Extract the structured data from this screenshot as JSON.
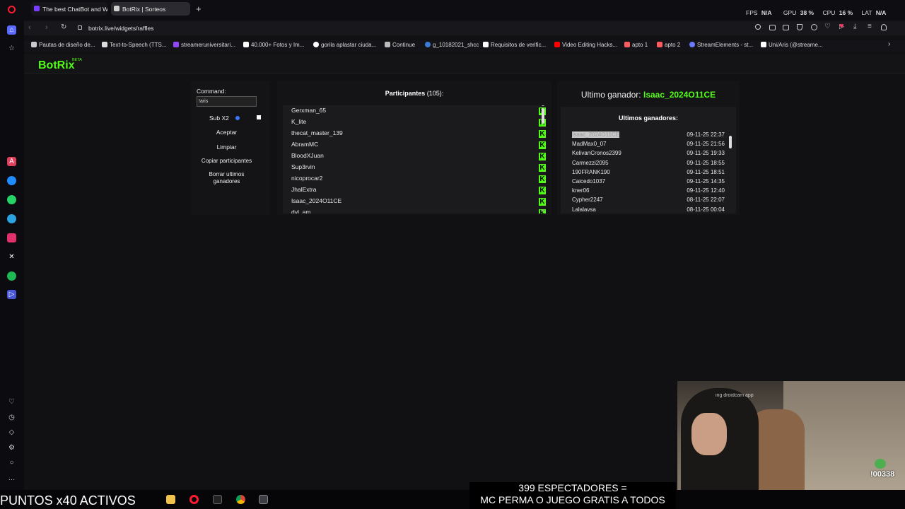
{
  "browser": {
    "tabs": [
      {
        "label": "The best ChatBot and Wi",
        "active": false
      },
      {
        "label": "BotRix | Sorteos",
        "active": true
      }
    ],
    "url": "botrix.live/widgets/raffles",
    "stats": {
      "fps_label": "FPS",
      "fps_value": "N/A",
      "gpu_label": "GPU",
      "gpu_value": "38 %",
      "cpu_label": "CPU",
      "cpu_value": "16 %",
      "lat_label": "LAT",
      "lat_value": "N/A"
    },
    "bookmarks": [
      "Pautas de diseño de...",
      "Text-to-Speech (TTS...",
      "streameruniversitari...",
      "40.000+ Fotos y Im...",
      "gorila aplastar ciuda...",
      "Continue",
      "g_10182021_shcc",
      "Requisitos de verific...",
      "Video Editing Hacks...",
      "apto 1",
      "apto 2",
      "StreamElements - st...",
      "Uni/Aris (@streame..."
    ]
  },
  "app": {
    "logo": "BotRix",
    "logo_badge": "BETA",
    "accent": "#53fc18"
  },
  "controls": {
    "command_label": "Command:",
    "command_value": "!aris",
    "sub_label": "Sub X2",
    "accept": "Aceptar",
    "clear": "Limpiar",
    "copy": "Copiar participantes",
    "delete_line1": "Borrar ultimos",
    "delete_line2": "ganadores"
  },
  "participants": {
    "title": "Participantes",
    "count": "(105):",
    "names": [
      "Gerxman_65",
      "K_lite",
      "thecat_master_139",
      "AbramMC",
      "BloodXJuan",
      "Sup3rvin",
      "nicoprocar2",
      "JhalExtra",
      "Isaac_2024O11CE",
      "dvl_am"
    ]
  },
  "winner": {
    "label": "Ultimo ganador:",
    "name": "Isaac_2024O11CE",
    "recent_title": "Ultimos ganadores:",
    "recent": [
      {
        "name": "Isaac_2024O11CE",
        "date": "09-11-25 22:37"
      },
      {
        "name": "MadMax0_07",
        "date": "09-11-25 21:56"
      },
      {
        "name": "KelivanCronos2399",
        "date": "09-11-25 19:33"
      },
      {
        "name": "Carmezzi2095",
        "date": "09-11-25 18:55"
      },
      {
        "name": "190FRANK190",
        "date": "09-11-25 18:51"
      },
      {
        "name": "Caicedo1037",
        "date": "09-11-25 14:35"
      },
      {
        "name": "kner06",
        "date": "09-11-25 12:40"
      },
      {
        "name": "Cypher2247",
        "date": "08-11-25 22:07"
      },
      {
        "name": "Lalalavsa",
        "date": "08-11-25 00:04"
      }
    ]
  },
  "overlay": {
    "points_ticker": "PUNTOS x40 ACTIVOS",
    "viewers_line1": "399 ESPECTADORES =",
    "viewers_line2": "MC PERMA O JUEGO GRATIS A TODOS",
    "cam_text": "ing droidcam app",
    "badge_count": "!00338"
  }
}
